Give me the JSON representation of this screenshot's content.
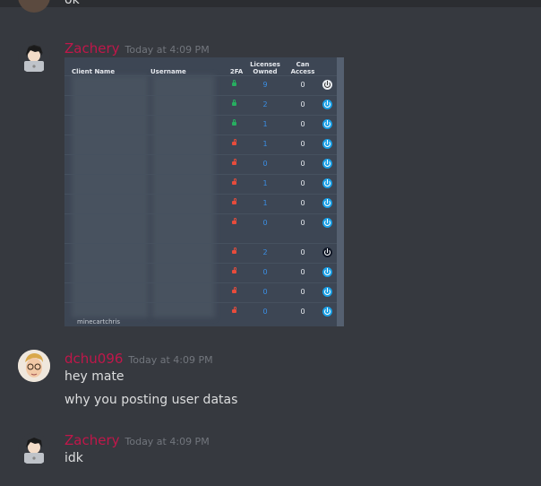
{
  "previous_message": {
    "text": "ok"
  },
  "messages": [
    {
      "author": "Zachery",
      "timestamp": "Today at 4:09 PM",
      "attachment": {
        "headers": {
          "client_name": "Client Name",
          "username": "Username",
          "twofa": "2FA",
          "licenses_owned": "Licenses Owned",
          "can_access": "Can Access"
        },
        "rows": [
          {
            "twofa": "on",
            "licenses": "9",
            "access": "0",
            "icon": "alt"
          },
          {
            "twofa": "on",
            "licenses": "2",
            "access": "0",
            "icon": "power"
          },
          {
            "twofa": "on",
            "licenses": "1",
            "access": "0",
            "icon": "power"
          },
          {
            "twofa": "off",
            "licenses": "1",
            "access": "0",
            "icon": "power"
          },
          {
            "twofa": "off",
            "licenses": "0",
            "access": "0",
            "icon": "power"
          },
          {
            "twofa": "off",
            "licenses": "1",
            "access": "0",
            "icon": "power"
          },
          {
            "twofa": "off",
            "licenses": "1",
            "access": "0",
            "icon": "power"
          },
          {
            "twofa": "off",
            "licenses": "0",
            "access": "0",
            "icon": "power"
          },
          {
            "twofa": "off",
            "licenses": "2",
            "access": "0",
            "icon": "dark"
          },
          {
            "twofa": "off",
            "licenses": "0",
            "access": "0",
            "icon": "power"
          },
          {
            "twofa": "off",
            "licenses": "0",
            "access": "0",
            "icon": "power"
          },
          {
            "twofa": "off",
            "licenses": "0",
            "access": "0",
            "icon": "power"
          }
        ],
        "footer_user": "minecartchris"
      }
    },
    {
      "author": "dchu096",
      "timestamp": "Today at 4:09 PM",
      "lines": [
        "hey mate",
        "why you posting user datas"
      ]
    },
    {
      "author": "Zachery",
      "timestamp": "Today at 4:09 PM",
      "lines": [
        "idk"
      ]
    }
  ],
  "colors": {
    "background": "#36393f",
    "username": "#c0174a",
    "timestamp": "#72767d",
    "text": "#dcddde"
  }
}
